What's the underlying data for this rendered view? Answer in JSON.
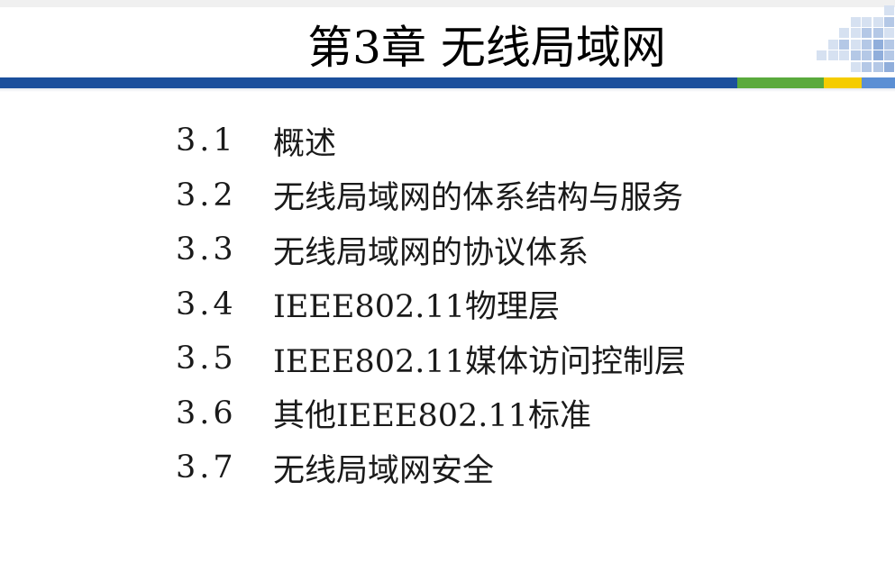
{
  "slide": {
    "title": "第3章  无线局域网"
  },
  "colors": {
    "bar_blue": "#1b4f9c",
    "bar_green": "#5aaa3c",
    "bar_yellow": "#f5cc00",
    "bar_lightblue": "#5b8fd4",
    "deco_light": "#d6e1f1",
    "deco_mid": "#b4c8e6",
    "deco_dark": "#90aedb"
  },
  "toc": [
    {
      "num": "3.1",
      "text": "概述"
    },
    {
      "num": "3.2",
      "text": "无线局域网的体系结构与服务"
    },
    {
      "num": "3.3",
      "text": "无线局域网的协议体系"
    },
    {
      "num": "3.4",
      "text": "IEEE802.11物理层"
    },
    {
      "num": "3.5",
      "text": "IEEE802.11媒体访问控制层"
    },
    {
      "num": "3.6",
      "text": "其他IEEE802.11标准"
    },
    {
      "num": "3.7",
      "text": "无线局域网安全"
    }
  ]
}
